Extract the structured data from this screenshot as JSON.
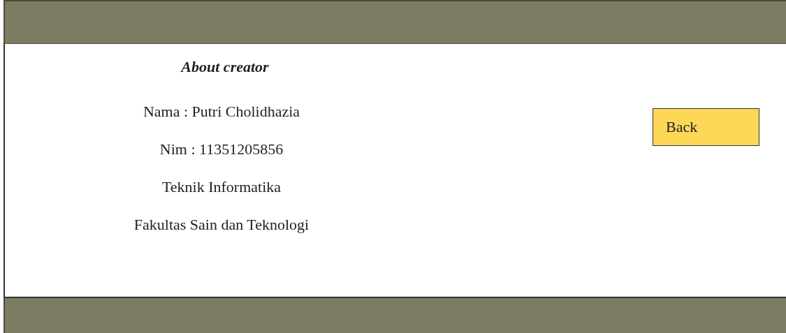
{
  "title": "About creator",
  "lines": [
    "Nama : Putri Cholidhazia",
    "Nim : 11351205856",
    "Teknik Informatika",
    "Fakultas Sain dan Teknologi"
  ],
  "button": {
    "label": "Back"
  }
}
